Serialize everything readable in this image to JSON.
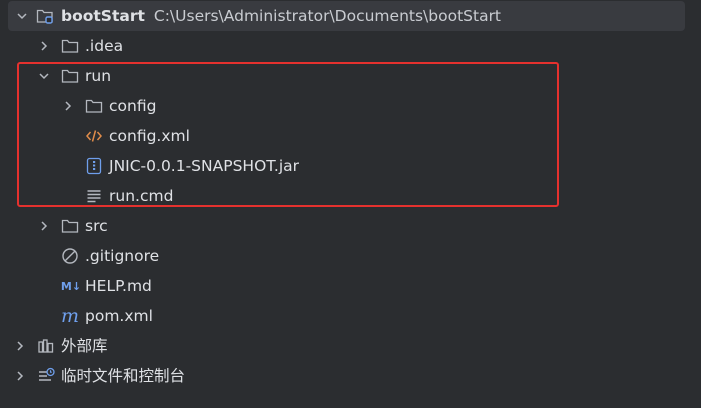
{
  "project": {
    "name": "bootStart",
    "path": "C:\\Users\\Administrator\\Documents\\bootStart"
  },
  "items": {
    "idea": ".idea",
    "run": "run",
    "config_dir": "config",
    "config_xml": "config.xml",
    "jar": "JNIC-0.0.1-SNAPSHOT.jar",
    "run_cmd": "run.cmd",
    "src": "src",
    "gitignore": ".gitignore",
    "help_md": "HELP.md",
    "md_icon_text": "M↓",
    "pom_xml": "pom.xml",
    "pom_icon_text": "m",
    "external_libs": "外部库",
    "scratches": "临时文件和控制台"
  },
  "colors": {
    "background": "#2b2d30",
    "selected_row": "#393b40",
    "highlight": "#e5312e",
    "xml_icon": "#e08c4a",
    "accent_blue": "#6f9fec"
  }
}
